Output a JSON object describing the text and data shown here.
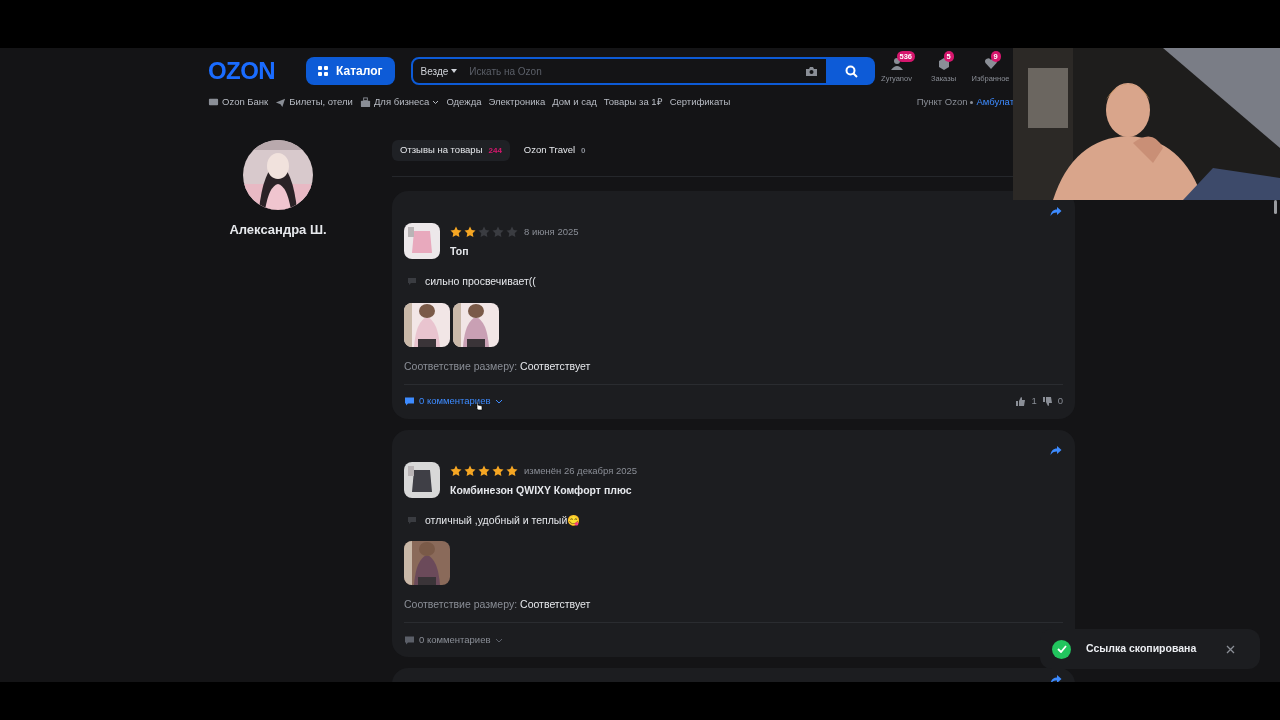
{
  "header": {
    "logo": "OZON",
    "catalog_button": "Каталог",
    "search": {
      "scope": "Везде",
      "placeholder": "Искать на Ozon"
    },
    "actions": [
      {
        "label": "Zyryanov",
        "badge": "536",
        "kind": "user"
      },
      {
        "label": "Заказы",
        "badge": "5",
        "kind": "box"
      },
      {
        "label": "Избранное",
        "badge": "9",
        "kind": "heart"
      }
    ]
  },
  "nav": [
    {
      "label": "Ozon Банк",
      "kind": "card"
    },
    {
      "label": "Билеты, отели",
      "kind": "plane"
    },
    {
      "label": "Для бизнеса",
      "kind": "business"
    },
    {
      "label": "Одежда",
      "kind": "plain"
    },
    {
      "label": "Электроника",
      "kind": "plain"
    },
    {
      "label": "Дом и сад",
      "kind": "plain"
    },
    {
      "label": "Товары за 1₽",
      "kind": "plain"
    },
    {
      "label": "Сертификаты",
      "kind": "plain"
    }
  ],
  "pickup": {
    "label": "Пункт Ozon",
    "value": "Амбулат"
  },
  "profile": {
    "name": "Александра Ш."
  },
  "tabs": [
    {
      "label": "Отзывы на товары",
      "count": "244",
      "selected": true
    },
    {
      "label": "Ozon Travel",
      "count": "0",
      "selected": false
    }
  ],
  "reviews": [
    {
      "stars": 2,
      "date": "8 июня 2025",
      "product": "Топ",
      "text": "сильно просвечивает((",
      "photos": [
        {
          "kind": "picture"
        },
        {
          "kind": "picture"
        }
      ],
      "size_label": "Соответствие размеру:",
      "size_value": "Соответствует",
      "comments": "0 комментариев",
      "hovered": true,
      "likes": "1",
      "dislikes": "0"
    },
    {
      "stars": 5,
      "date": "изменён 26 декабря 2025",
      "product": "Комбинезон QWIXY Комфорт плюс",
      "text": "отличный ,удобный и теплый😋",
      "photos": [
        {
          "kind": "picture"
        }
      ],
      "size_label": "Соответствие размеру:",
      "size_value": "Соответствует",
      "comments": "0 комментариев",
      "hovered": false
    }
  ],
  "toast": {
    "text": "Ссылка скопирована"
  }
}
